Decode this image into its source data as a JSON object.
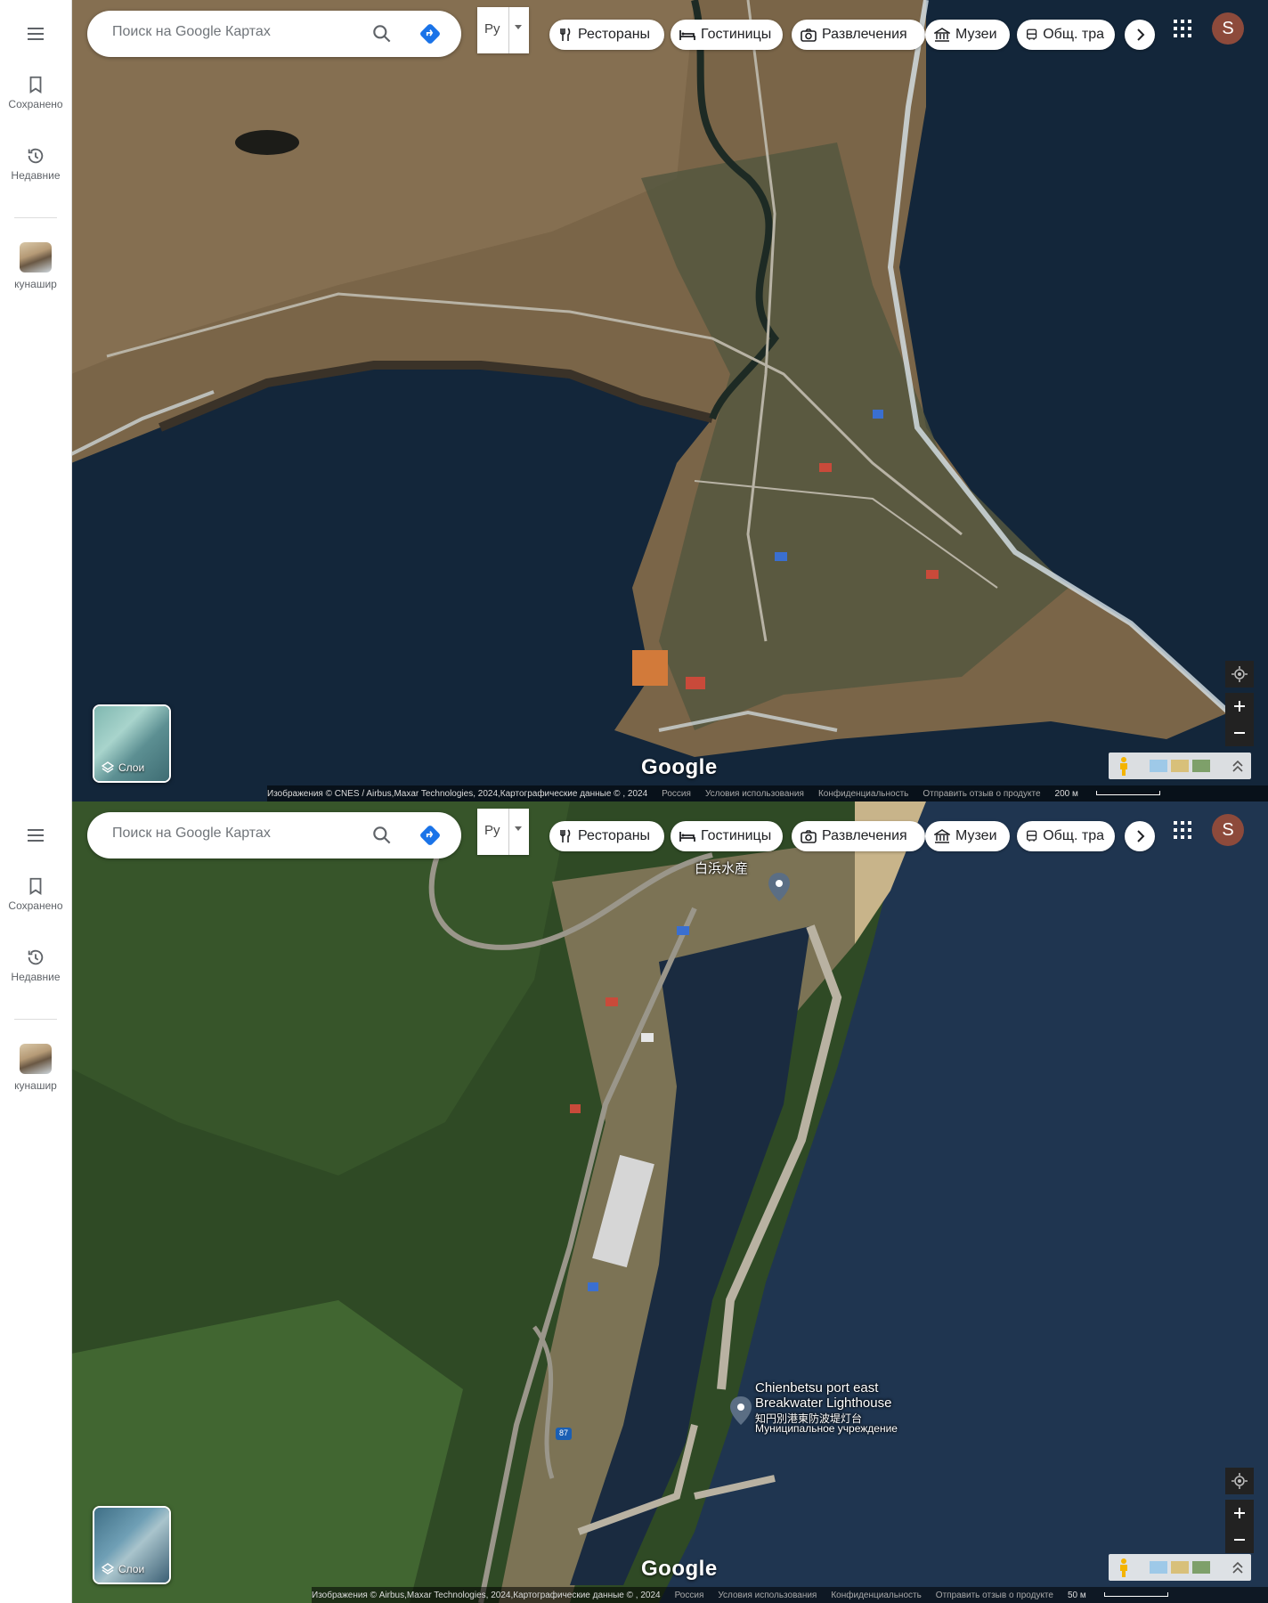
{
  "panels": [
    {
      "sidebar": {
        "saved_label": "Сохранено",
        "recent_label": "Недавние",
        "recent_search_label": "кунашир"
      },
      "search": {
        "placeholder": "Поиск на Google Картах"
      },
      "lang": "Ру",
      "chips": [
        {
          "label": "Рестораны",
          "icon": "fork-knife-icon"
        },
        {
          "label": "Гостиницы",
          "icon": "bed-icon"
        },
        {
          "label": "Развлечения",
          "icon": "camera-icon"
        },
        {
          "label": "Музеи",
          "icon": "museum-icon"
        },
        {
          "label": "Общ. тра",
          "icon": "bus-icon"
        }
      ],
      "avatar_letter": "S",
      "layers_label": "Слои",
      "google_logo": "Google",
      "footer": {
        "attribution": "Изображения © CNES / Airbus,Maxar Technologies, 2024,Картографические данные © , 2024",
        "region": "Россия",
        "terms": "Условия использования",
        "privacy": "Конфиденциальность",
        "feedback": "Отправить отзыв о продукте",
        "scale": "200 м"
      }
    },
    {
      "sidebar": {
        "saved_label": "Сохранено",
        "recent_label": "Недавние",
        "recent_search_label": "кунашир"
      },
      "search": {
        "placeholder": "Поиск на Google Картах"
      },
      "lang": "Ру",
      "chips": [
        {
          "label": "Рестораны",
          "icon": "fork-knife-icon"
        },
        {
          "label": "Гостиницы",
          "icon": "bed-icon"
        },
        {
          "label": "Развлечения",
          "icon": "camera-icon"
        },
        {
          "label": "Музеи",
          "icon": "museum-icon"
        },
        {
          "label": "Общ. тра",
          "icon": "bus-icon"
        }
      ],
      "avatar_letter": "S",
      "layers_label": "Слои",
      "google_logo": "Google",
      "map_labels": {
        "shop": "白浜水産",
        "lighthouse_en_1": "Chienbetsu port east",
        "lighthouse_en_2": "Breakwater Lighthouse",
        "lighthouse_jp": "知円別港東防波堤灯台",
        "lighthouse_type": "Муниципальное учреждение",
        "route": "87"
      },
      "footer": {
        "attribution": "Изображения © Airbus,Maxar Technologies, 2024,Картографические данные © , 2024",
        "region": "Россия",
        "terms": "Условия использования",
        "privacy": "Конфиденциальность",
        "feedback": "Отправить отзыв о продукте",
        "scale": "50 м"
      }
    }
  ],
  "colors": {
    "sea": "#13263a",
    "land": "#7a6548",
    "forest": "#2f4a25",
    "accent": "#1a73e8"
  }
}
